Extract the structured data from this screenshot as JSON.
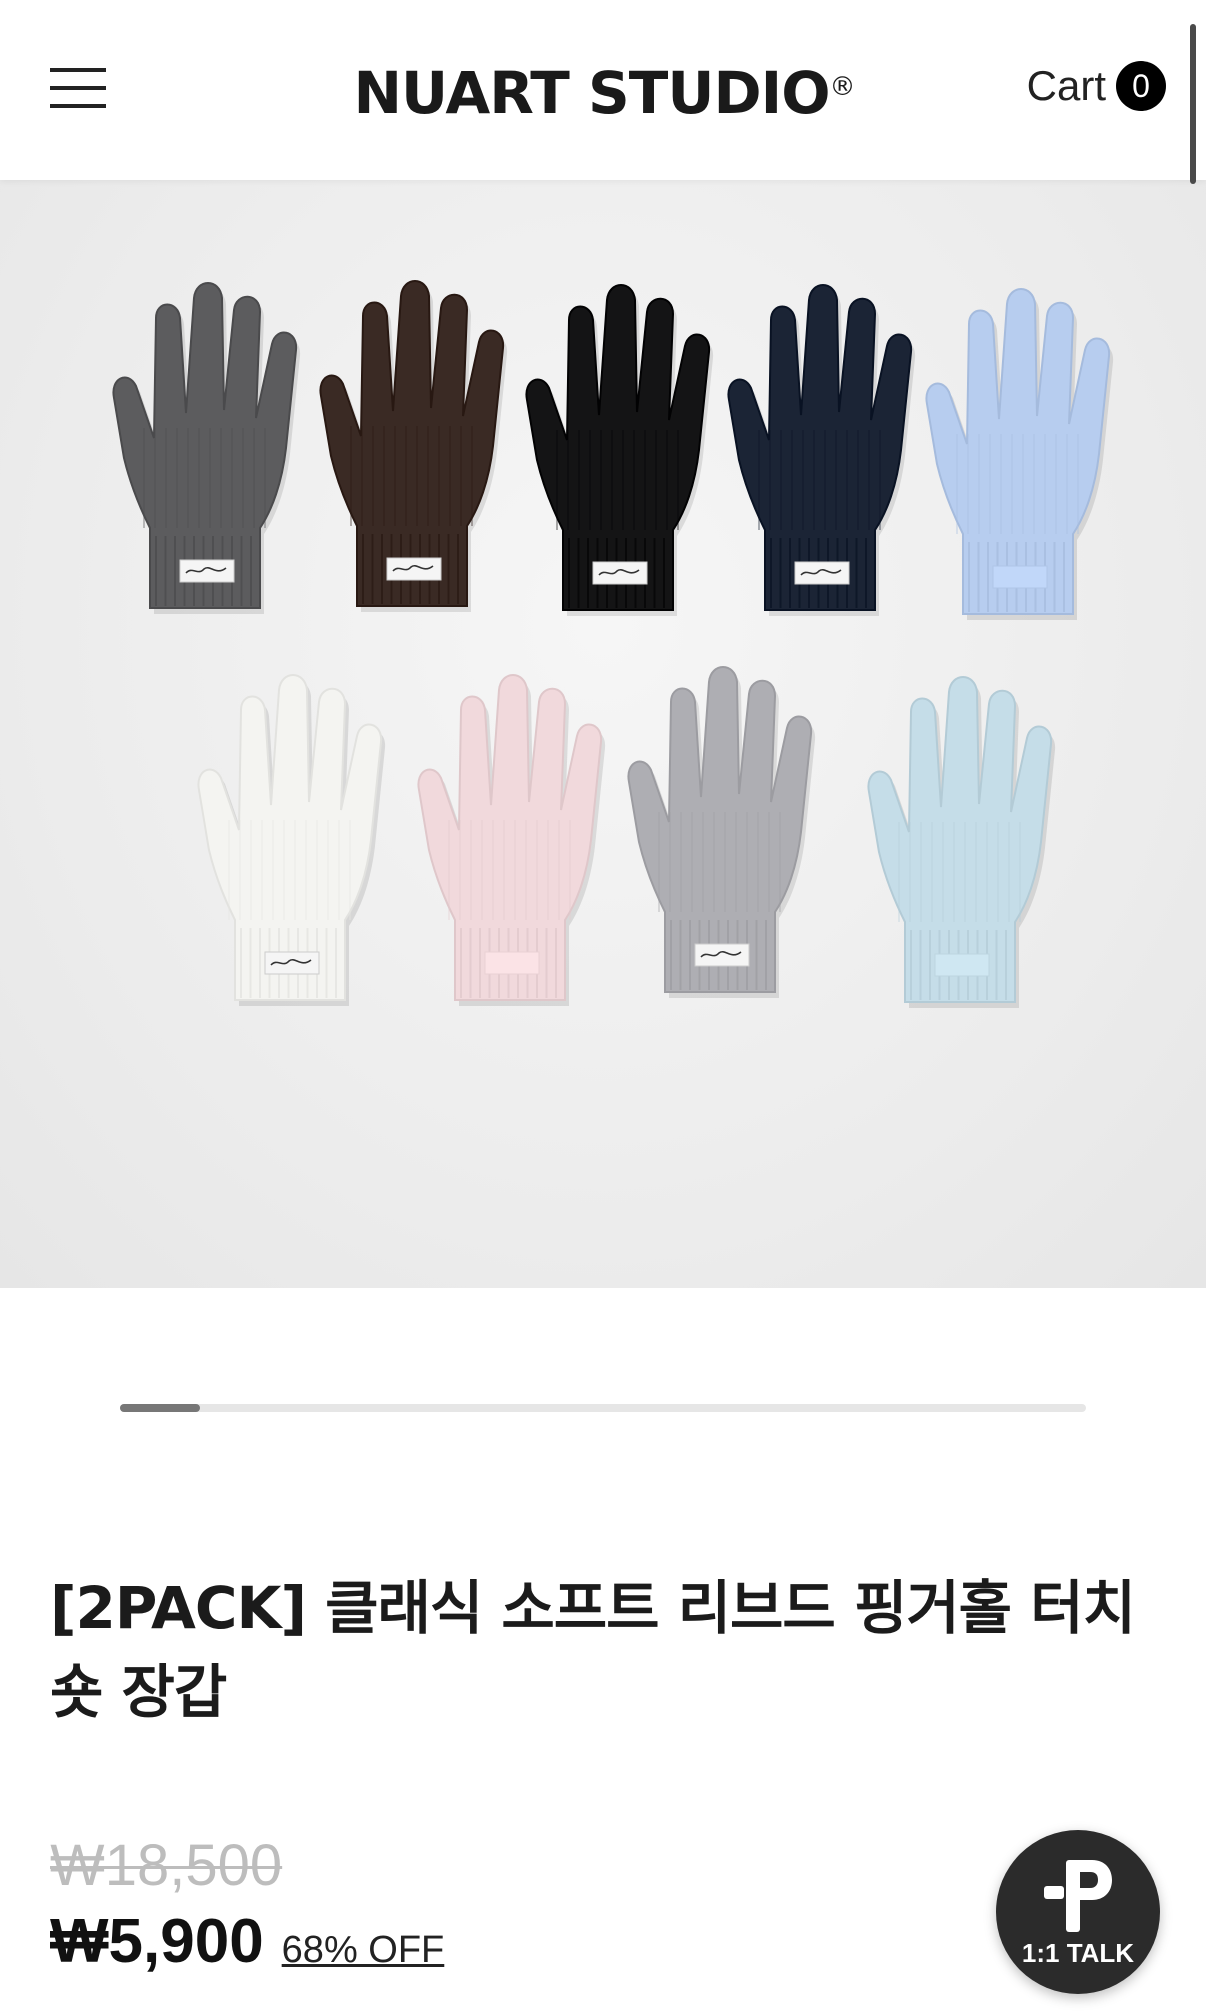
{
  "header": {
    "logo_text": "NUART STUDIO",
    "logo_mark": "®",
    "cart_label": "Cart",
    "cart_count": "0"
  },
  "icons": {
    "menu": "hamburger-menu-icon",
    "talk": "p-logo-icon"
  },
  "gallery": {
    "image_count": 12,
    "current_image": 1,
    "glove_colors_row1": [
      "#5c5c5e",
      "#3a2a24",
      "#141415",
      "#1b2435",
      "#b7cdef"
    ],
    "glove_colors_row2": [
      "#f4f4f1",
      "#f1d9dc",
      "#aeaeb3",
      "#c5dde8"
    ],
    "color_swatches": [
      "#131718",
      "#1e2536",
      "#2c2428",
      "#55545c",
      "#b2b1bd",
      "#dfe5e8",
      "#b9cdee",
      "#f3e2e4",
      "#f6f5ef"
    ]
  },
  "product": {
    "title": "[2PACK] 클래식 소프트 리브드 핑거홀 터치숏 장갑",
    "original_price": "₩18,500",
    "sale_price": "₩5,900",
    "discount": "68% OFF"
  },
  "talk_button": {
    "label": "1:1 TALK"
  }
}
